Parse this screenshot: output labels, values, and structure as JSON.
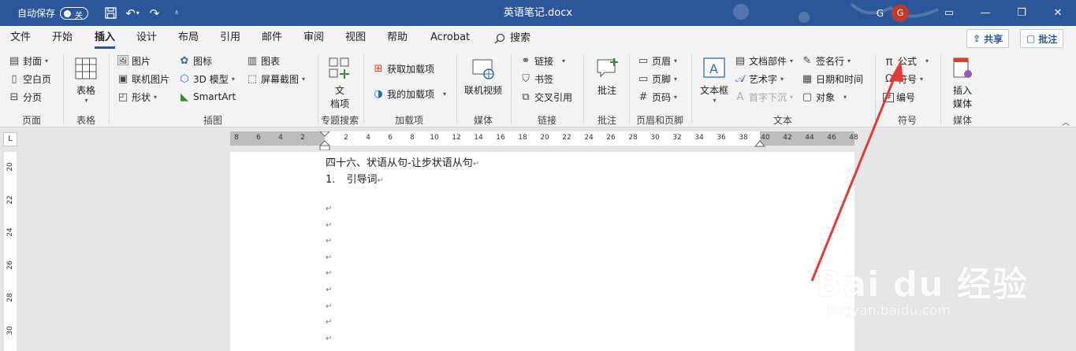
{
  "titlebar": {
    "autosave_label": "自动保存",
    "autosave_state": "关",
    "doc_title": "英语笔记.docx",
    "user_initial": "G",
    "avatar_letter": "G"
  },
  "tabs": {
    "file": "文件",
    "home": "开始",
    "insert": "插入",
    "design": "设计",
    "layout": "布局",
    "references": "引用",
    "mailings": "邮件",
    "review": "审阅",
    "view": "视图",
    "help": "帮助",
    "acrobat": "Acrobat",
    "search": "搜索",
    "share": "共享",
    "comments": "批注"
  },
  "ribbon": {
    "pages": {
      "cover": "封面",
      "blank": "空白页",
      "break": "分页",
      "group": "页面"
    },
    "table": {
      "table": "表格",
      "group": "表格"
    },
    "illustrations": {
      "picture": "图片",
      "online_picture": "联机图片",
      "shapes": "形状",
      "icons": "图标",
      "model3d": "3D 模型",
      "smartart": "SmartArt",
      "chart": "图表",
      "screenshot": "屏幕截图",
      "group": "插图"
    },
    "docsearch": {
      "doc_item_line1": "文",
      "doc_item_line2": "档项",
      "group": "专题搜索"
    },
    "addins": {
      "get": "获取加载项",
      "mine": "我的加载项",
      "group": "加载项"
    },
    "media": {
      "online_video": "联机视频",
      "group": "媒体"
    },
    "links": {
      "link": "链接",
      "bookmark": "书签",
      "crossref": "交叉引用",
      "group": "链接"
    },
    "comments": {
      "comment": "批注",
      "group": "批注"
    },
    "headerfooter": {
      "header": "页眉",
      "footer": "页脚",
      "pagenum": "页码",
      "group": "页眉和页脚"
    },
    "text": {
      "textbox": "文本框",
      "quickparts": "文档部件",
      "wordart": "艺术字",
      "dropcap": "首字下沉",
      "signature": "签名行",
      "datetime": "日期和时间",
      "object": "对象",
      "group": "文本"
    },
    "symbols": {
      "equation": "公式",
      "symbol": "符号",
      "number": "编号",
      "group": "符号"
    },
    "embedmedia": {
      "line1": "插入",
      "line2": "媒体",
      "group": "媒体"
    }
  },
  "ruler": {
    "corner": "L",
    "h_ticks_left": [
      "8",
      "6",
      "4",
      "2"
    ],
    "h_ticks_right": [
      "2",
      "4",
      "6",
      "8",
      "10",
      "12",
      "14",
      "16",
      "18",
      "20",
      "22",
      "24",
      "26",
      "28",
      "30",
      "32",
      "34",
      "36",
      "38",
      "40",
      "42",
      "44",
      "46",
      "48"
    ],
    "v_ticks": [
      "20",
      "22",
      "24",
      "26",
      "28",
      "30"
    ]
  },
  "document": {
    "heading": "四十六、状语从句-让步状语从句",
    "item_number": "1.",
    "item_text": "引导词",
    "para_mark": "↵"
  },
  "watermark": {
    "main": "Bai du 经验",
    "sub": "jingyan.baidu.com"
  },
  "colors": {
    "titlebar": "#2b579a",
    "ribbon": "#f3f3f3",
    "arrow": "#e53935",
    "avatar": "#c0392b"
  }
}
